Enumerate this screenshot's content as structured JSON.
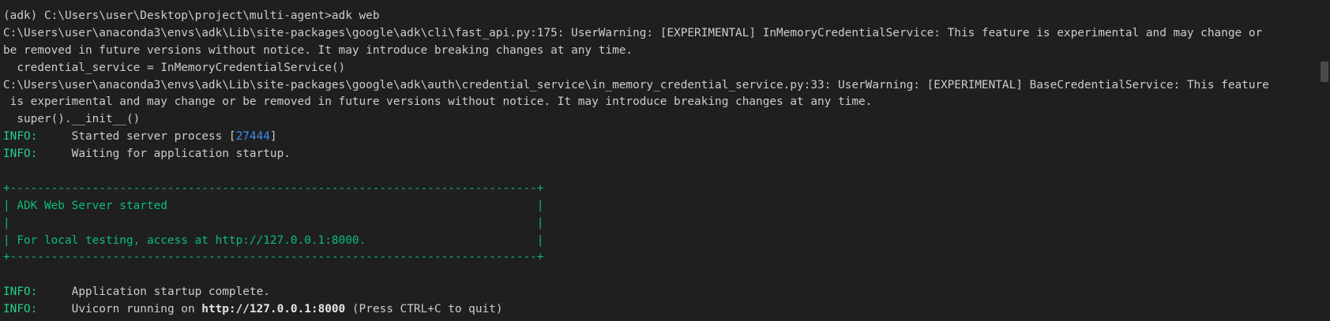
{
  "terminal": {
    "prompt_line": "(adk) C:\\Users\\user\\Desktop\\project\\multi-agent>adk web",
    "warning1_line1": "C:\\Users\\user\\anaconda3\\envs\\adk\\Lib\\site-packages\\google\\adk\\cli\\fast_api.py:175: UserWarning: [EXPERIMENTAL] InMemoryCredentialService: This feature is experimental and may change or",
    "warning1_line2": "be removed in future versions without notice. It may introduce breaking changes at any time.",
    "warning1_code": "  credential_service = InMemoryCredentialService()",
    "warning2_line1": "C:\\Users\\user\\anaconda3\\envs\\adk\\Lib\\site-packages\\google\\adk\\auth\\credential_service\\in_memory_credential_service.py:33: UserWarning: [EXPERIMENTAL] BaseCredentialService: This feature",
    "warning2_line2": " is experimental and may change or be removed in future versions without notice. It may introduce breaking changes at any time.",
    "warning2_code": "  super().__init__()",
    "info_label": "INFO:",
    "info_spacer": "     ",
    "log1_prefix": "Started server process [",
    "log1_pid": "27444",
    "log1_suffix": "]",
    "log2": "Waiting for application startup.",
    "box_border": "+-----------------------------------------------------------------------------+",
    "box_line1": "| ADK Web Server started                                                      |",
    "box_line2": "|                                                                             |",
    "box_line3": "| For local testing, access at http://127.0.0.1:8000.                         |",
    "log3": "Application startup complete.",
    "log4_prefix": "Uvicorn running on ",
    "log4_url": "http://127.0.0.1:8000",
    "log4_suffix": " (Press CTRL+C to quit)"
  },
  "colors": {
    "background": "#1f1f1f",
    "text": "#cccccc",
    "info": "#23d18b",
    "number": "#3b8eea",
    "box": "#0dbc79"
  }
}
